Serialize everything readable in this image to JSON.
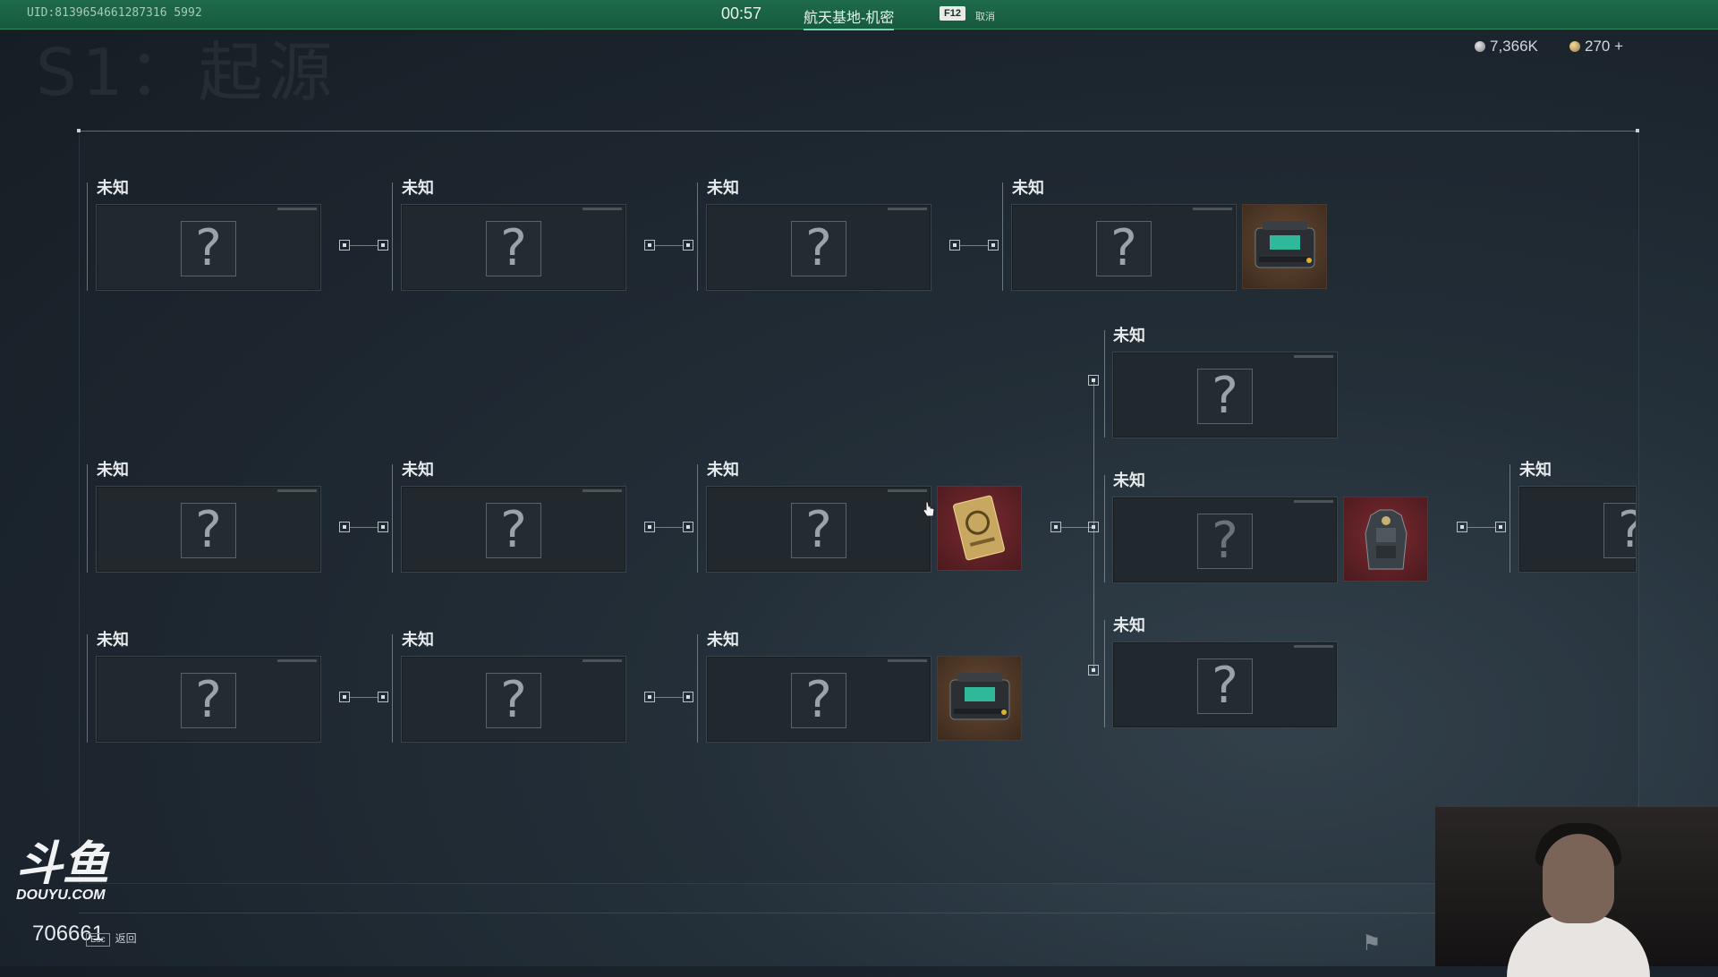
{
  "topbar": {
    "uid": "UID:8139654661287316 5992",
    "timer": "00:57",
    "map_name": "航天基地-机密",
    "key_hint": "F12",
    "cancel_label": "取消"
  },
  "background_title": "S1：起源",
  "currency": {
    "silver": "7,366K",
    "gold": "270 +"
  },
  "nodes": {
    "r1c1": "未知",
    "r1c2": "未知",
    "r1c3": "未知",
    "r1c4": "未知",
    "b1": "未知",
    "r2c1": "未知",
    "r2c2": "未知",
    "r2c3": "未知",
    "b2": "未知",
    "r2c6": "未知",
    "r3c1": "未知",
    "r3c2": "未知",
    "r3c3": "未知",
    "b3": "未知"
  },
  "question_mark": "?",
  "rewards": [
    {
      "id": "tech-case-1",
      "icon": "tech-case-icon",
      "color": "#6a4a32"
    },
    {
      "id": "gold-card",
      "icon": "gold-card-icon",
      "color": "#7a2a30"
    },
    {
      "id": "armor-vest",
      "icon": "armor-vest-icon",
      "color": "#7a2a30"
    },
    {
      "id": "tech-case-2",
      "icon": "tech-case-icon",
      "color": "#6a4a32"
    }
  ],
  "stream": {
    "logo_mark": "斗鱼",
    "logo_site": "DOUYU.COM",
    "room_id": "706661"
  },
  "footer": {
    "esc_key": "Esc",
    "back_label": "返回"
  }
}
